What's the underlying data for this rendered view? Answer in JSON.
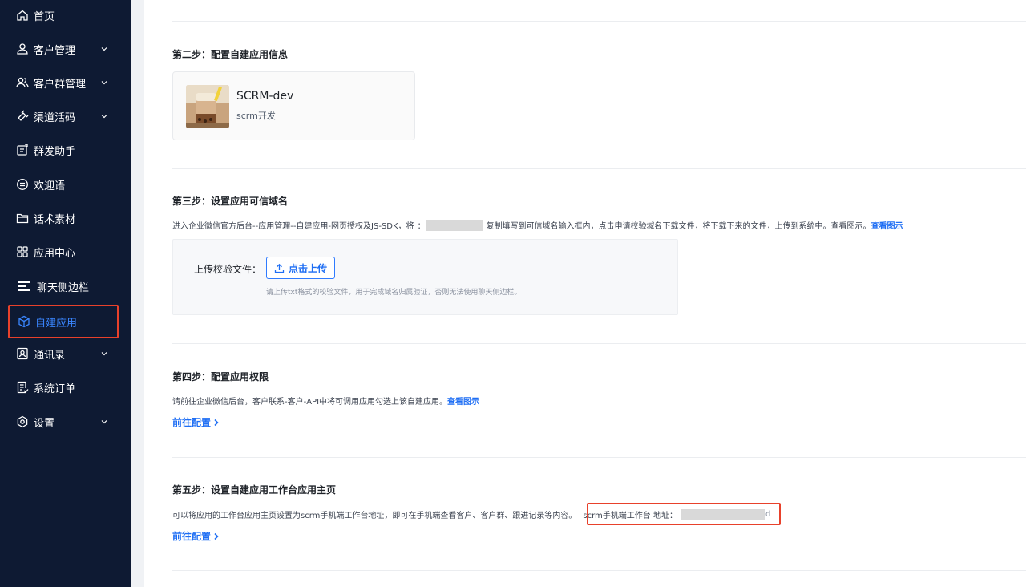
{
  "sidebar": {
    "items": [
      {
        "label": "首页",
        "icon": "home-icon",
        "expandable": false
      },
      {
        "label": "客户管理",
        "icon": "user-icon",
        "expandable": true
      },
      {
        "label": "客户群管理",
        "icon": "users-icon",
        "expandable": true
      },
      {
        "label": "渠道活码",
        "icon": "qrcode-icon",
        "expandable": true
      },
      {
        "label": "群发助手",
        "icon": "broadcast-icon",
        "expandable": false
      },
      {
        "label": "欢迎语",
        "icon": "message-icon",
        "expandable": false
      },
      {
        "label": "话术素材",
        "icon": "folder-icon",
        "expandable": false
      },
      {
        "label": "应用中心",
        "icon": "grid-icon",
        "expandable": false
      },
      {
        "label": "聊天侧边栏",
        "icon": "sidebar-icon",
        "expandable": false
      },
      {
        "label": "自建应用",
        "icon": "cube-icon",
        "expandable": false,
        "active": true
      },
      {
        "label": "通讯录",
        "icon": "contacts-icon",
        "expandable": true
      },
      {
        "label": "系统订单",
        "icon": "order-icon",
        "expandable": false
      },
      {
        "label": "设置",
        "icon": "gear-icon",
        "expandable": true
      }
    ],
    "active_color": "#3a86ff"
  },
  "step2": {
    "title": "第二步：配置自建应用信息",
    "app": {
      "name": "SCRM-dev",
      "desc": "scrm开发"
    }
  },
  "step3": {
    "title": "第三步：设置应用可信域名",
    "desc_prefix": "进入企业微信官方后台--应用管理--自建应用-网页授权及JS-SDK，将",
    "desc_masked": "：",
    "desc_suffix": "复制填写到可信域名输入框内，点击申请校验域名下载文件，将下载下来的文件，上传到系统中。查看图示。",
    "view_link": "查看图示",
    "upload_label": "上传校验文件：",
    "upload_button": "点击上传",
    "upload_hint": "请上传txt格式的校验文件，用于完成域名归属验证，否则无法使用聊天侧边栏。"
  },
  "step4": {
    "title": "第四步：配置应用权限",
    "desc": "请前往企业微信后台，客户联系-客户-API中将可调用应用勾选上该自建应用。",
    "view_link": "查看图示",
    "goto": "前往配置"
  },
  "step5": {
    "title": "第五步：设置自建应用工作台应用主页",
    "desc": "可以将应用的工作台应用主页设置为scrm手机端工作台地址，即可在手机端查看客户、客户群、跟进记录等内容。",
    "addr_label": "scrm手机端工作台 地址：",
    "addr_suffix": "d",
    "goto": "前往配置"
  },
  "colors": {
    "sidebar_bg": "#0e1a33",
    "link": "#1e6ef4",
    "highlight": "#e8412b"
  }
}
